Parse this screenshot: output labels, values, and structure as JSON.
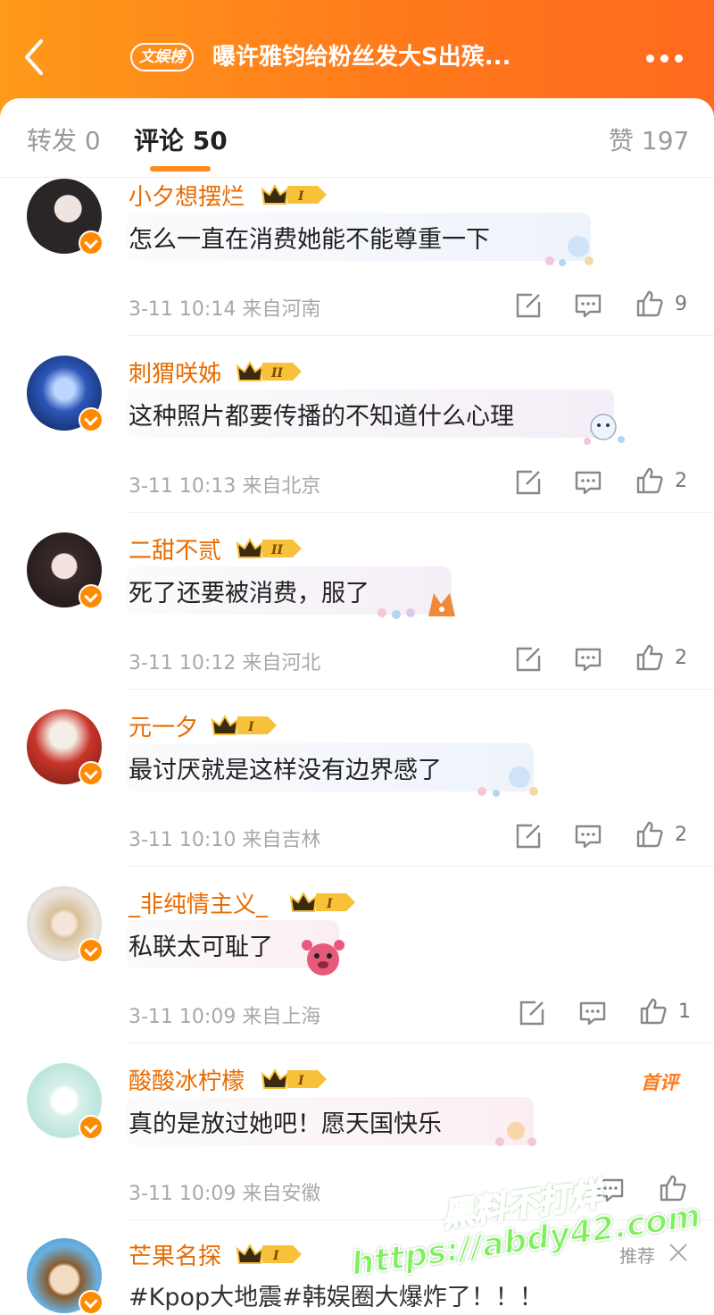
{
  "header": {
    "badge": "文娱榜",
    "title": "曝许雅钧给粉丝发大S出殡..."
  },
  "tabs": {
    "repost": "转发 0",
    "comments": "评论 50",
    "likes": "赞 197"
  },
  "colors": {
    "accent": "#ff7a1c",
    "username": "#e86b00"
  },
  "comments": [
    {
      "user": "小夕想摆烂",
      "level": "I",
      "text": "怎么一直在消费她能不能尊重一下",
      "meta": "3-11 10:14  来自河南",
      "likes": "9"
    },
    {
      "user": "刺猬咲姊",
      "level": "II",
      "text": "这种照片都要传播的不知道什么心理",
      "meta": "3-11 10:13  来自北京",
      "likes": "2"
    },
    {
      "user": "二甜不贰",
      "level": "II",
      "text": "死了还要被消费，服了",
      "meta": "3-11 10:12  来自河北",
      "likes": "2"
    },
    {
      "user": "元一夕",
      "level": "I",
      "text": "最讨厌就是这样没有边界感了",
      "meta": "3-11 10:10  来自吉林",
      "likes": "2"
    },
    {
      "user": "_非纯情主义_",
      "level": "I",
      "text": "私联太可耻了",
      "meta": "3-11 10:09  来自上海",
      "likes": "1"
    },
    {
      "user": "酸酸冰柠檬",
      "level": "I",
      "text": "真的是放过她吧！愿天国快乐",
      "meta": "3-11 10:09  来自安徽",
      "likes": ""
    },
    {
      "user": "芒果名探",
      "level": "I",
      "text": "#Kpop大地震#韩娱圈大爆炸了！！！",
      "meta": "",
      "likes": ""
    }
  ],
  "first_comment_tag": "首评",
  "recommend": "推荐",
  "watermark": {
    "line1": "黑料不打烊",
    "line2": "https://abdy42.com"
  }
}
